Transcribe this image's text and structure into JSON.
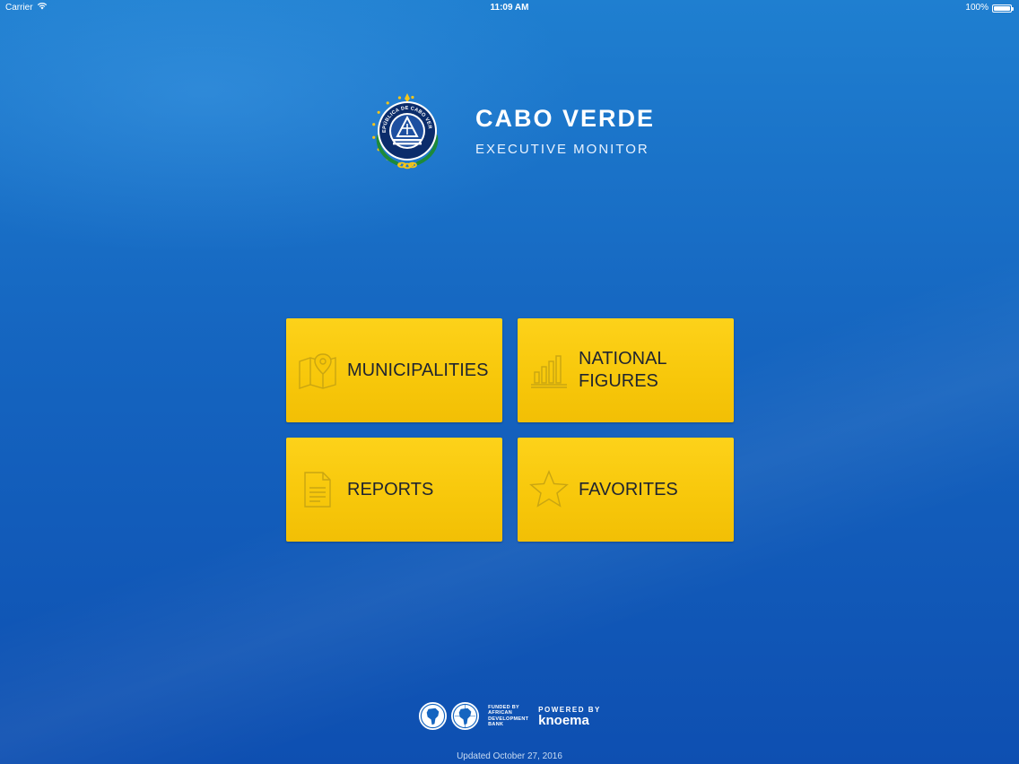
{
  "status_bar": {
    "carrier": "Carrier",
    "time": "11:09 AM",
    "battery": "100%",
    "battery_level": 1.0
  },
  "header": {
    "title": "CABO VERDE",
    "subtitle": "EXECUTIVE MONITOR",
    "emblem_text": "REPÚBLICA DE CABO VERDE"
  },
  "tiles": [
    {
      "label": "MUNICIPALITIES",
      "icon": "map-pin-icon"
    },
    {
      "label": "NATIONAL\nFIGURES",
      "icon": "bar-chart-icon"
    },
    {
      "label": "REPORTS",
      "icon": "document-icon"
    },
    {
      "label": "FAVORITES",
      "icon": "star-icon"
    }
  ],
  "footer": {
    "funded_by": "FUNDED BY AFRICAN DEVELOPMENT BANK",
    "powered_by": "POWERED BY",
    "brand": "knoema",
    "updated": "Updated October 27, 2016"
  },
  "colors": {
    "background_top": "#1f7fd0",
    "background_bottom": "#0e4fb1",
    "tile_yellow": "#f7c70a",
    "tile_text": "#1f2430",
    "emblem_navy": "#0b2c6b",
    "emblem_green": "#1d8a3a",
    "emblem_gold": "#f5c518"
  }
}
